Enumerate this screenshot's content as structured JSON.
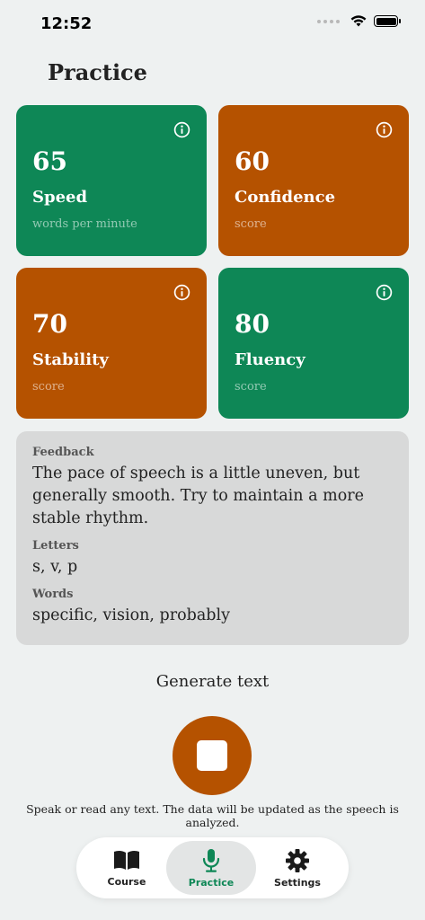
{
  "status_bar": {
    "time": "12:52"
  },
  "header": {
    "title": "Practice"
  },
  "metrics": [
    {
      "value": "65",
      "label": "Speed",
      "sub": "words per minute",
      "color": "#0e8756"
    },
    {
      "value": "60",
      "label": "Confidence",
      "sub": "score",
      "color": "#b55200"
    },
    {
      "value": "70",
      "label": "Stability",
      "sub": "score",
      "color": "#b55200"
    },
    {
      "value": "80",
      "label": "Fluency",
      "sub": "score",
      "color": "#0e8756"
    }
  ],
  "feedback": {
    "feedback_heading": "Feedback",
    "feedback_text": "The pace of speech is a little uneven, but generally smooth. Try to maintain a more stable rhythm.",
    "letters_heading": "Letters",
    "letters_text": "s, v, p",
    "words_heading": "Words",
    "words_text": "specific, vision, probably"
  },
  "actions": {
    "generate_text": "Generate text",
    "hint": "Speak or read any text. The data will be updated as the speech is analyzed."
  },
  "tabs": [
    {
      "label": "Course",
      "icon": "book-icon",
      "active": false
    },
    {
      "label": "Practice",
      "icon": "microphone-icon",
      "active": true
    },
    {
      "label": "Settings",
      "icon": "gear-icon",
      "active": false
    }
  ],
  "colors": {
    "green": "#0e8756",
    "orange": "#b55200",
    "background": "#eef1f1"
  }
}
